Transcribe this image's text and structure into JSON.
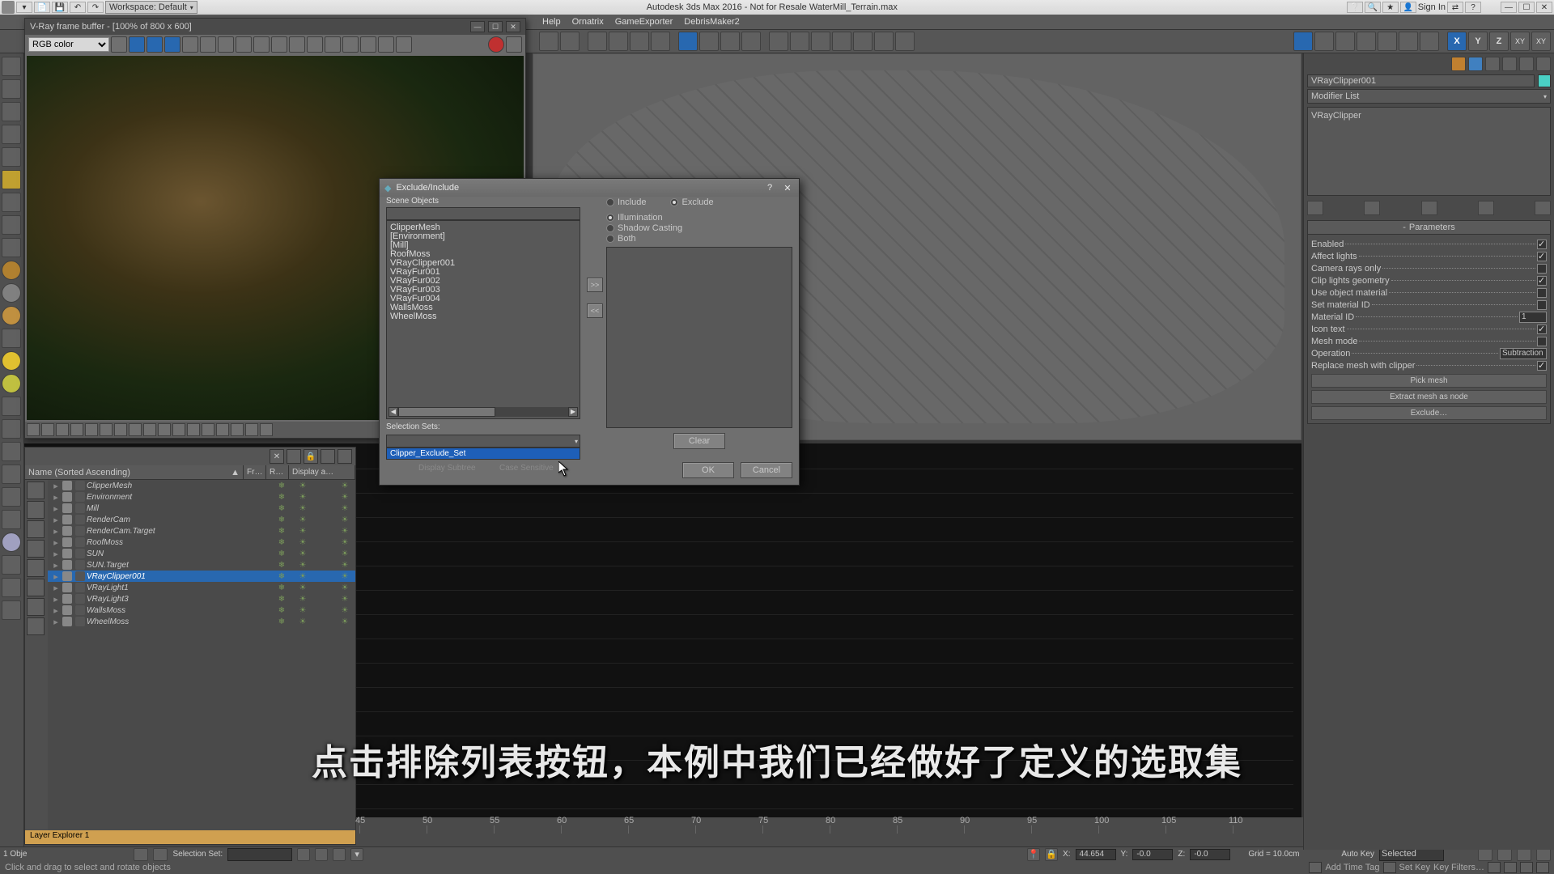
{
  "title_bar": {
    "app_title": "Autodesk 3ds Max 2016 - Not for Resale   WaterMill_Terrain.max",
    "workspace_label": "Workspace: Default",
    "sign_in": "Sign In"
  },
  "menu_bar": {
    "items": [
      "Help",
      "Ornatrix",
      "GameExporter",
      "DebrisMaker2"
    ]
  },
  "vfb": {
    "title": "V-Ray frame buffer - [100% of 800 x 600]",
    "channel": "RGB color"
  },
  "right_panel": {
    "obj_name": "VRayClipper001",
    "modifier_list": "Modifier List",
    "stack_item": "VRayClipper",
    "rollout": "Parameters",
    "params": {
      "enabled": "Enabled",
      "affect_lights": "Affect lights",
      "camera_rays": "Camera rays only",
      "clip_lights": "Clip lights geometry",
      "use_obj_mtl": "Use object material",
      "set_mtl_id": "Set material ID",
      "mtl_id": "Material ID",
      "mtl_id_val": "1",
      "icon_text": "Icon text",
      "mesh_mode": "Mesh mode",
      "operation": "Operation",
      "operation_val": "Subtraction",
      "replace_mesh": "Replace mesh with clipper",
      "pick_mesh": "Pick mesh",
      "extract": "Extract mesh as node",
      "exclude": "Exclude…"
    }
  },
  "scene_explorer": {
    "header": {
      "name": "Name (Sorted Ascending)",
      "frozen": "Fr…",
      "render": "R…",
      "display": "Display a…"
    },
    "rows": [
      {
        "name": "ClipperMesh"
      },
      {
        "name": "Environment"
      },
      {
        "name": "Mill"
      },
      {
        "name": "RenderCam"
      },
      {
        "name": "RenderCam.Target"
      },
      {
        "name": "RoofMoss"
      },
      {
        "name": "SUN"
      },
      {
        "name": "SUN.Target"
      },
      {
        "name": "VRayClipper001",
        "selected": true
      },
      {
        "name": "VRayLight1"
      },
      {
        "name": "VRayLight3"
      },
      {
        "name": "WallsMoss"
      },
      {
        "name": "WheelMoss"
      }
    ],
    "tab": "Layer Explorer 1",
    "selset_label": "Selection Set:"
  },
  "timeslider": {
    "ticks": [
      "45",
      "50",
      "55",
      "60",
      "65",
      "70",
      "75",
      "80",
      "85",
      "90",
      "95",
      "100",
      "105",
      "110"
    ]
  },
  "status": {
    "objects": "1 Obje",
    "x_lbl": "X:",
    "x": "44.654",
    "y_lbl": "Y:",
    "y": "-0.0",
    "z_lbl": "Z:",
    "z": "-0.0",
    "grid": "Grid = 10.0cm",
    "autokey": "Auto Key",
    "selected": "Selected",
    "setkey": "Set Key",
    "keyfilters": "Key Filters…",
    "addtag": "Add Time Tag"
  },
  "prompt": "Click and drag to select and rotate objects",
  "dialog": {
    "title": "Exclude/Include",
    "scene_objects_lbl": "Scene Objects",
    "objects": [
      "ClipperMesh",
      "[Environment]",
      "[Mill]",
      "RoofMoss",
      "VRayClipper001",
      "VRayFur001",
      "VRayFur002",
      "VRayFur003",
      "VRayFur004",
      "WallsMoss",
      "WheelMoss"
    ],
    "sel_sets_lbl": "Selection Sets:",
    "sel_sets_option": "Clipper_Exclude_Set",
    "display_subtree": "Display Subtree",
    "case_sensitive": "Case Sensitive",
    "include": "Include",
    "exclude": "Exclude",
    "illumination": "Illumination",
    "shadow": "Shadow Casting",
    "both": "Both",
    "move_right": ">>",
    "move_left": "<<",
    "clear": "Clear",
    "ok": "OK",
    "cancel": "Cancel"
  },
  "subtitle": "点击排除列表按钮，本例中我们已经做好了定义的选取集"
}
